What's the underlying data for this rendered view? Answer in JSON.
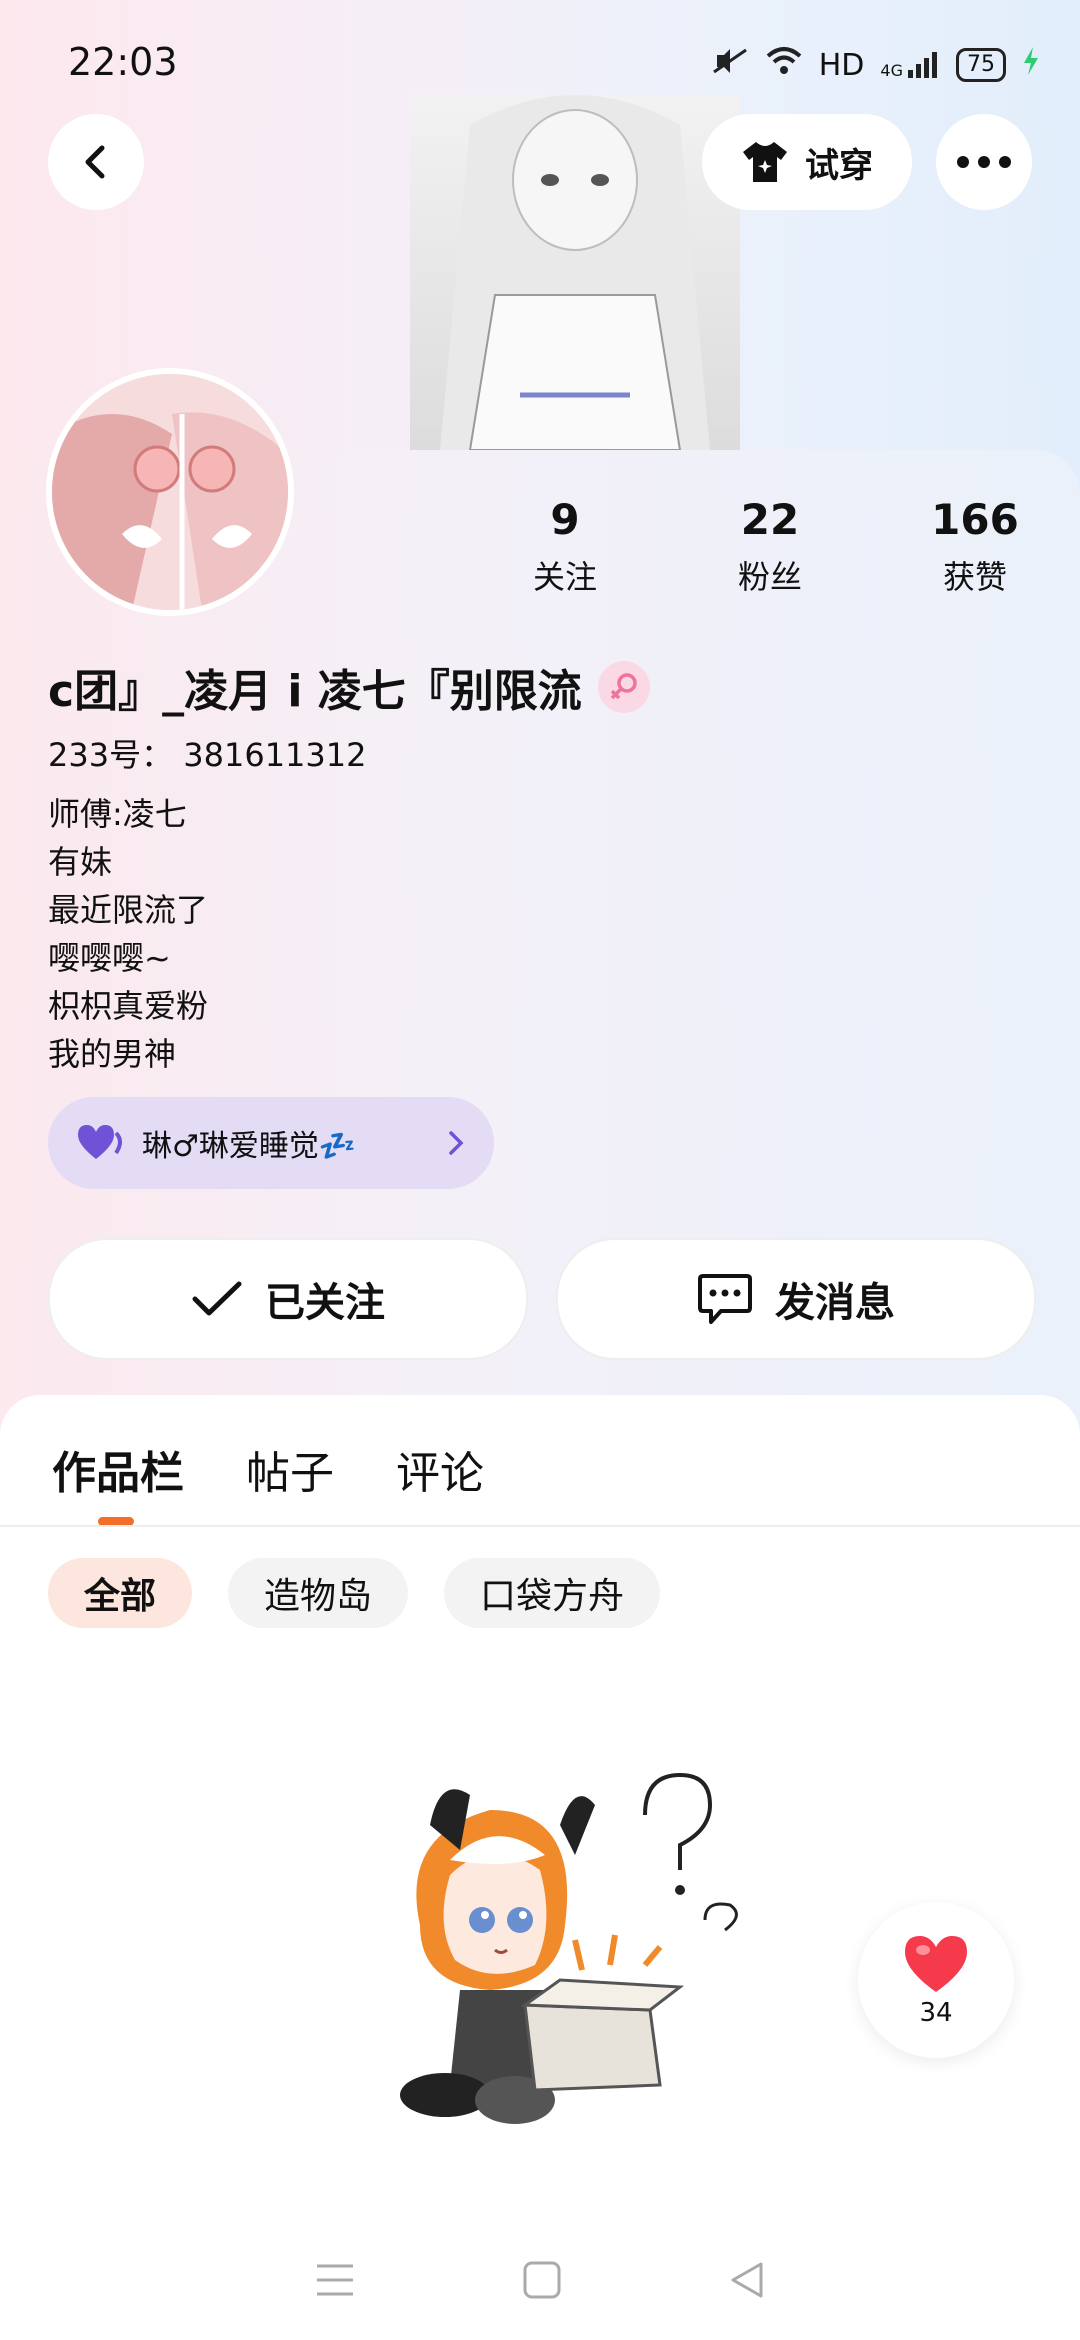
{
  "status_bar": {
    "time": "22:03",
    "network": "HD",
    "signal": "4G",
    "battery": "75"
  },
  "header": {
    "try_on_label": "试穿"
  },
  "profile": {
    "stats": [
      {
        "value": "9",
        "label": "关注"
      },
      {
        "value": "22",
        "label": "粉丝"
      },
      {
        "value": "166",
        "label": "获赞"
      }
    ],
    "username": "c团』_凌月 i 凌七『别限流",
    "uid": "233号： 381611312",
    "bio": [
      "师傅:凌七",
      "有妹",
      "最近限流了",
      "嘤嘤嘤~",
      "枳枳真爱粉",
      "我的男神"
    ],
    "medal": {
      "name": "琳♂琳爱睡觉💤"
    },
    "follow_label": "已关注",
    "message_label": "发消息"
  },
  "tabs": [
    "作品栏",
    "帖子",
    "评论"
  ],
  "chips": [
    "全部",
    "造物岛",
    "口袋方舟"
  ],
  "like": {
    "count": "34"
  },
  "colors": {
    "accent": "#f26e2a",
    "heart": "#f43a4b",
    "medal_bg": "#e3dcf4"
  }
}
